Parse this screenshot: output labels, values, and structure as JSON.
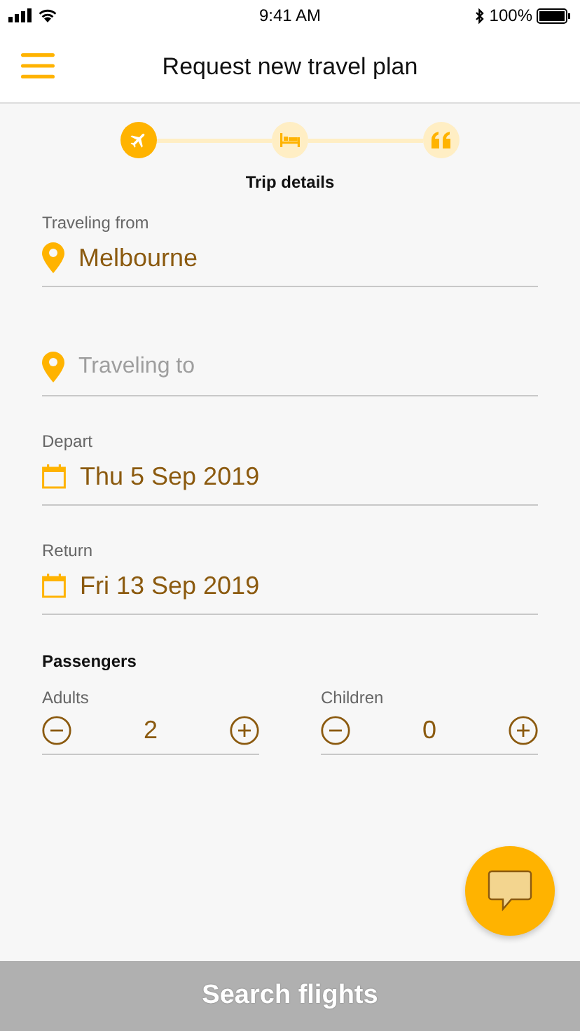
{
  "status_bar": {
    "time": "9:41 AM",
    "battery": "100%"
  },
  "header": {
    "title": "Request new travel plan"
  },
  "steps": [
    {
      "kind": "plane",
      "selected": true
    },
    {
      "kind": "bed",
      "selected": false
    },
    {
      "kind": "quote",
      "selected": false
    }
  ],
  "step_label": "Trip details",
  "fields": [
    {
      "kind": "location",
      "label": "Traveling from",
      "value": "Melbourne"
    },
    {
      "kind": "location",
      "placeholder": "Traveling to"
    },
    {
      "kind": "date",
      "label": "Depart",
      "value": "Thu 5 Sep 2019"
    },
    {
      "kind": "date",
      "label": "Return",
      "value": "Fri 13 Sep 2019"
    }
  ],
  "passengers": {
    "title": "Passengers",
    "counters": [
      {
        "label": "Adults",
        "value": "2"
      },
      {
        "label": "Children",
        "value": "0"
      }
    ]
  },
  "search_button": {
    "label": "Search flights",
    "disabled": true
  }
}
